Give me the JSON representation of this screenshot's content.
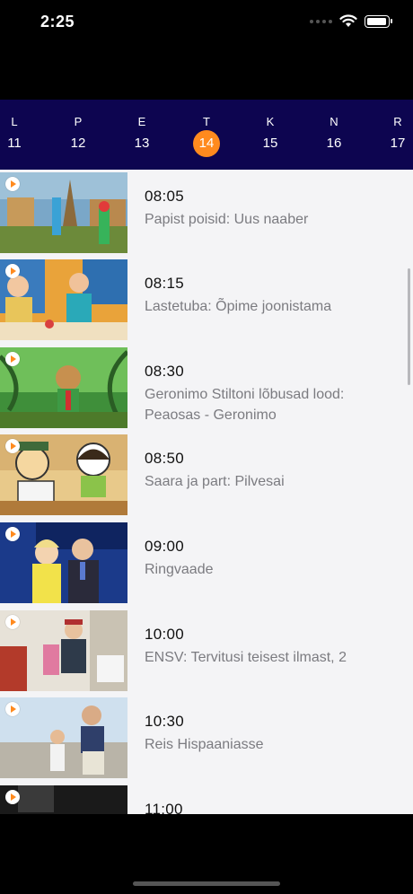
{
  "status_bar": {
    "time": "2:25"
  },
  "days": [
    {
      "letter": "L",
      "number": "11",
      "active": false
    },
    {
      "letter": "P",
      "number": "12",
      "active": false
    },
    {
      "letter": "E",
      "number": "13",
      "active": false
    },
    {
      "letter": "T",
      "number": "14",
      "active": true
    },
    {
      "letter": "K",
      "number": "15",
      "active": false
    },
    {
      "letter": "N",
      "number": "16",
      "active": false
    },
    {
      "letter": "R",
      "number": "17",
      "active": false
    }
  ],
  "programs": [
    {
      "time": "08:05",
      "title": "Papist poisid:  Uus naaber"
    },
    {
      "time": "08:15",
      "title": "Lastetuba:  Õpime joonistama"
    },
    {
      "time": "08:30",
      "title": "Geronimo Stiltoni lõbusad lood: Peaosas - Geronimo"
    },
    {
      "time": "08:50",
      "title": "Saara ja part:  Pilvesai"
    },
    {
      "time": "09:00",
      "title": "Ringvaade"
    },
    {
      "time": "10:00",
      "title": "ENSV:  Tervitusi teisest ilmast, 2"
    },
    {
      "time": "10:30",
      "title": "Reis Hispaaniasse"
    },
    {
      "time": "11:00",
      "title": ""
    }
  ],
  "colors": {
    "header_bg": "#0d0550",
    "accent": "#ff8a1e",
    "list_bg": "#f4f4f6"
  }
}
